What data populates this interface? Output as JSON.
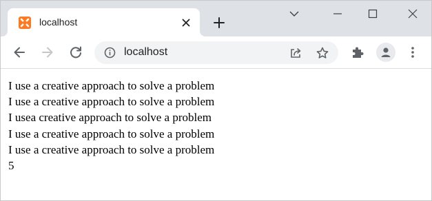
{
  "browser": {
    "tab": {
      "title": "localhost",
      "favicon_icon": "xampp-icon",
      "favicon_color": "#fb7a24"
    },
    "new_tab_icon": "plus-icon",
    "window_controls": [
      "chevron-down-icon",
      "minimize-icon",
      "maximize-icon",
      "close-icon"
    ],
    "toolbar": {
      "back_icon": "arrow-left-icon",
      "forward_icon": "arrow-right-icon",
      "reload_icon": "reload-icon",
      "site_info_icon": "info-icon",
      "address": "localhost",
      "share_icon": "share-icon",
      "bookmark_icon": "star-icon",
      "extensions_icon": "puzzle-icon",
      "profile_icon": "person-icon",
      "menu_icon": "kebab-menu-icon"
    }
  },
  "page": {
    "lines": [
      "I use a creative approach to solve a problem",
      "I use a creative approach to solve a problem",
      "I usea creative approach to solve a problem",
      "I use a creative approach to solve a problem",
      "I use a creative approach to solve a problem",
      "5"
    ]
  }
}
